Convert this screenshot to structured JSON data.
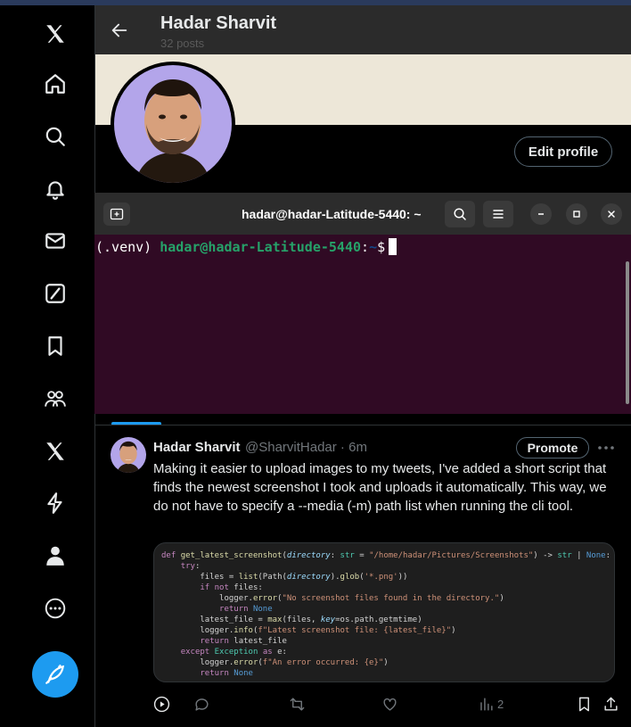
{
  "nav": {
    "items": [
      "x-logo",
      "home",
      "search",
      "notifications",
      "messages",
      "grok",
      "bookmarks",
      "communities",
      "premium",
      "verified-orgs",
      "profile",
      "more"
    ],
    "post_button_icon": "feather-icon"
  },
  "header": {
    "name": "Hadar Sharvit",
    "posts": "32 posts"
  },
  "profile": {
    "edit_label": "Edit profile"
  },
  "terminal": {
    "title": "hadar@hadar-Latitude-5440: ~",
    "prompt_env": "(.venv) ",
    "prompt_user": "hadar@hadar-Latitude-5440",
    "prompt_sep": ":",
    "prompt_path": "~",
    "prompt_symbol": "$"
  },
  "tweet": {
    "name": "Hadar Sharvit",
    "handle": "@SharvitHadar · 6m",
    "promote_label": "Promote",
    "text": "Making it easier to upload images to my tweets, I've added a short script that finds the newest screenshot I took and uploads it automatically. This way, we do not have to specify a --media (-m) path list when running the cli tool.",
    "views": "2",
    "code_lines": [
      "def get_latest_screenshot(directory: str = \"/home/hadar/Pictures/Screenshots\") -> str | None:",
      "    try:",
      "        files = list(Path(directory).glob('*.png'))",
      "        if not files:",
      "            logger.error(\"No screenshot files found in the directory.\")",
      "            return None",
      "        latest_file = max(files, key=os.path.getmtime)",
      "        logger.info(f\"Latest screenshot file: {latest_file}\")",
      "        return latest_file",
      "    except Exception as e:",
      "        logger.error(f\"An error occurred: {e}\")",
      "        return None"
    ]
  },
  "colors": {
    "accent": "#1d9bf0",
    "terminal_bg": "#300a24",
    "prompt_user": "#26a269",
    "prompt_path": "#12488b"
  }
}
